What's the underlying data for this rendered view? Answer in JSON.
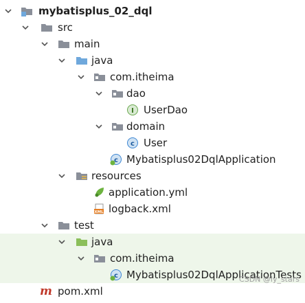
{
  "tree": {
    "items": [
      {
        "label": "mybatisplus_02_dql",
        "icon": "module-folder-icon",
        "expanded": true
      },
      {
        "label": "src",
        "icon": "folder-icon",
        "expanded": true
      },
      {
        "label": "main",
        "icon": "folder-icon",
        "expanded": true
      },
      {
        "label": "java",
        "icon": "source-root-folder-icon",
        "expanded": true
      },
      {
        "label": "com.itheima",
        "icon": "package-icon",
        "expanded": true
      },
      {
        "label": "dao",
        "icon": "package-icon",
        "expanded": true
      },
      {
        "label": "UserDao",
        "icon": "interface-icon"
      },
      {
        "label": "domain",
        "icon": "package-icon",
        "expanded": true
      },
      {
        "label": "User",
        "icon": "class-icon"
      },
      {
        "label": "Mybatisplus02DqlApplication",
        "icon": "spring-boot-class-icon"
      },
      {
        "label": "resources",
        "icon": "resources-folder-icon",
        "expanded": true
      },
      {
        "label": "application.yml",
        "icon": "spring-yml-icon"
      },
      {
        "label": "logback.xml",
        "icon": "xml-file-icon"
      },
      {
        "label": "test",
        "icon": "folder-icon",
        "expanded": true
      },
      {
        "label": "java",
        "icon": "test-root-folder-icon",
        "expanded": true
      },
      {
        "label": "com.itheima",
        "icon": "package-icon",
        "expanded": true
      },
      {
        "label": "Mybatisplus02DqlApplicationTests",
        "icon": "spring-boot-test-class-icon"
      },
      {
        "label": "pom.xml",
        "icon": "maven-icon"
      }
    ]
  },
  "watermark": "CSDN @ly_stars",
  "colors": {
    "folder": "#8a8f99",
    "source_root": "#6fa8dc",
    "test_root": "#8bbf5a",
    "test_highlight": "#eef6ea",
    "class_circle": "#3d86d3",
    "interface_circle": "#6aa84f",
    "spring_green": "#6db33f",
    "maven": "#c0392b"
  }
}
